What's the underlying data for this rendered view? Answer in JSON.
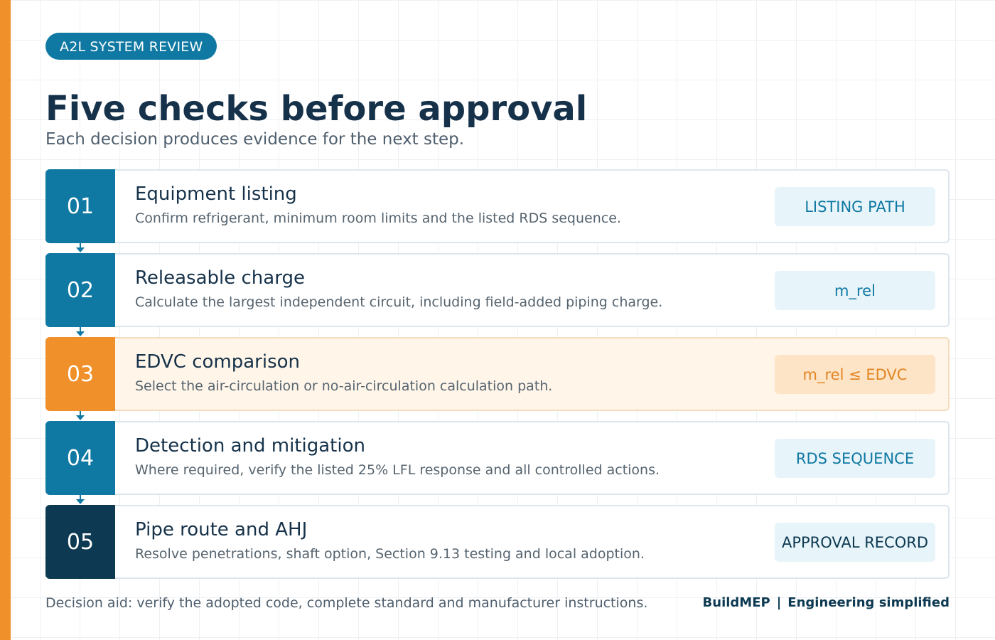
{
  "badge": "A2L SYSTEM REVIEW",
  "title": "Five checks before approval",
  "subtitle": "Each decision produces evidence for the next step.",
  "colors": {
    "accent_orange": "#f0902a",
    "primary_blue": "#1079a3",
    "navy": "#0d3a52",
    "highlight_bg": "#fff5e9"
  },
  "steps": [
    {
      "number": "01",
      "title": "Equipment listing",
      "description": "Confirm refrigerant, minimum room limits and the listed RDS sequence.",
      "tag": "LISTING PATH"
    },
    {
      "number": "02",
      "title": "Releasable charge",
      "description": "Calculate the largest independent circuit, including field-added piping charge.",
      "tag": "m_rel"
    },
    {
      "number": "03",
      "title": "EDVC comparison",
      "description": "Select the air-circulation or no-air-circulation calculation path.",
      "tag": "m_rel ≤ EDVC"
    },
    {
      "number": "04",
      "title": "Detection and mitigation",
      "description": "Where required, verify the listed 25% LFL response and all controlled actions.",
      "tag": "RDS SEQUENCE"
    },
    {
      "number": "05",
      "title": "Pipe route and AHJ",
      "description": "Resolve penetrations, shaft option, Section 9.13 testing and local adoption.",
      "tag": "APPROVAL RECORD"
    }
  ],
  "footer": {
    "note": "Decision aid: verify the adopted code, complete standard and manufacturer instructions.",
    "brand": "BuildMEP",
    "separator": "|",
    "tagline": "Engineering simplified"
  }
}
